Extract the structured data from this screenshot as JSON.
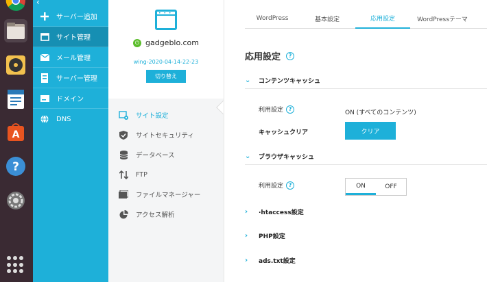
{
  "sidebar": {
    "items": [
      {
        "label": "サーバー追加",
        "icon": "plus-icon"
      },
      {
        "label": "サイト管理",
        "icon": "browser-window-icon"
      },
      {
        "label": "メール管理",
        "icon": "mail-icon"
      },
      {
        "label": "サーバー管理",
        "icon": "server-icon"
      },
      {
        "label": "ドメイン",
        "icon": "domain-card-icon"
      },
      {
        "label": "DNS",
        "icon": "globe-icon"
      }
    ]
  },
  "site": {
    "domain": "gadgeblo.com",
    "server": "wing-2020-04-14-22-23",
    "switch_label": "切り替え",
    "menu": [
      {
        "label": "サイト設定",
        "icon": "site-settings-icon"
      },
      {
        "label": "サイトセキュリティ",
        "icon": "shield-icon"
      },
      {
        "label": "データベース",
        "icon": "database-icon"
      },
      {
        "label": "FTP",
        "icon": "ftp-arrows-icon"
      },
      {
        "label": "ファイルマネージャー",
        "icon": "folder-icon"
      },
      {
        "label": "アクセス解析",
        "icon": "pie-chart-icon"
      }
    ]
  },
  "tabs": [
    "WordPress",
    "基本設定",
    "応用設定",
    "WordPressテーマ"
  ],
  "page_title": "応用設定",
  "content_cache": {
    "title": "コンテンツキャッシュ",
    "usage_label": "利用設定",
    "usage_value": "ON (すべてのコンテンツ)",
    "clear_label": "キャッシュクリア",
    "clear_button": "クリア"
  },
  "browser_cache": {
    "title": "ブラウザキャッシュ",
    "usage_label": "利用設定",
    "on_label": "ON",
    "off_label": "OFF"
  },
  "sections": [
    "htaccess設定",
    "PHP設定",
    "ads.txt設定"
  ],
  "colors": {
    "accent": "#1eb0d9",
    "dock": "#3a2a33"
  }
}
